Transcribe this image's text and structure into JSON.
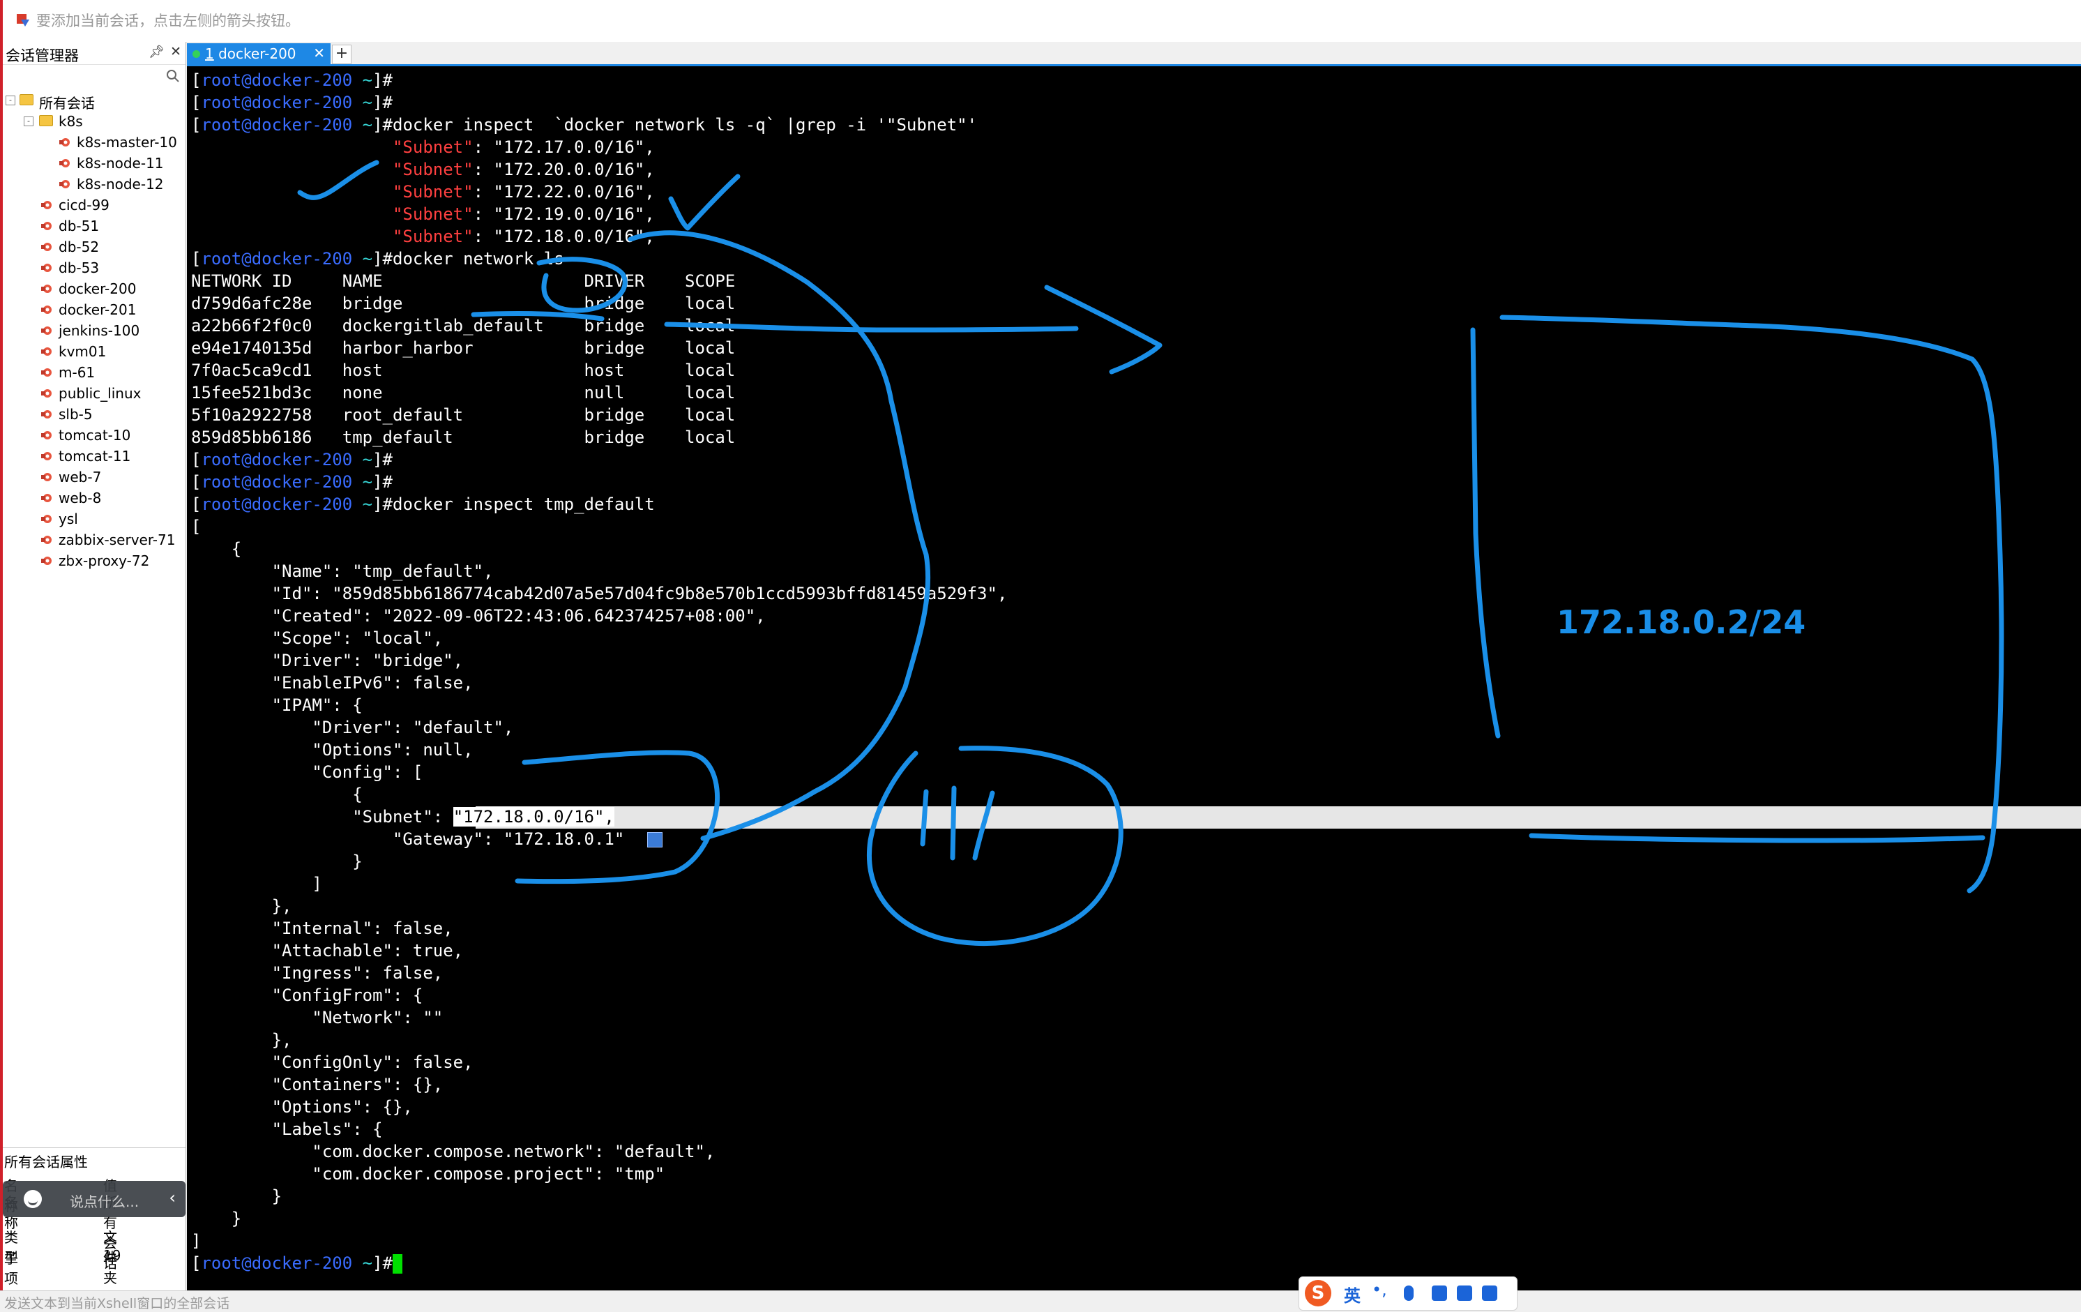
{
  "hint": {
    "text": "要添加当前会话，点击左侧的箭头按钮。"
  },
  "session_manager": {
    "title": "会话管理器",
    "root_label": "所有会话",
    "folder_label": "k8s",
    "folder_children": [
      "k8s-master-10",
      "k8s-node-11",
      "k8s-node-12"
    ],
    "sessions": [
      "cicd-99",
      "db-51",
      "db-52",
      "db-53",
      "docker-200",
      "docker-201",
      "jenkins-100",
      "kvm01",
      "m-61",
      "public_linux",
      "slb-5",
      "tomcat-10",
      "tomcat-11",
      "web-7",
      "web-8",
      "ysl",
      "zabbix-server-71",
      "zbx-proxy-72"
    ]
  },
  "properties": {
    "title": "所有会话属性",
    "name_col": "名称",
    "value_col": "值",
    "rows": [
      {
        "k": "名称",
        "v": "所有会话"
      },
      {
        "k": "类型",
        "v": "文件夹"
      },
      {
        "k": "子项目",
        "v": "19"
      }
    ],
    "chat_placeholder": "说点什么..."
  },
  "tab": {
    "number": "1",
    "label": "docker-200",
    "add": "+"
  },
  "terminal": {
    "prompt_user": "root@docker-200",
    "prompt_dir": "~",
    "cmd_inspect_grep": "docker inspect  `docker network ls -q` |grep -i '\"Subnet\"'",
    "subnets": [
      "172.17.0.0/16",
      "172.20.0.0/16",
      "172.22.0.0/16",
      "172.19.0.0/16",
      "172.18.0.0/16"
    ],
    "cmd_network_ls": "docker network ls",
    "ls_header": "NETWORK ID     NAME                    DRIVER    SCOPE",
    "ls_rows": [
      "d759d6afc28e   bridge                  bridge    local",
      "a22b66f2f0c0   dockergitlab_default    bridge    local",
      "e94e1740135d   harbor_harbor           bridge    local",
      "7f0ac5ca9cd1   host                    host      local",
      "15fee521bd3c   none                    null      local",
      "5f10a2922758   root_default            bridge    local",
      "859d85bb6186   tmp_default             bridge    local"
    ],
    "cmd_inspect_tmp": "docker inspect tmp_default",
    "json_lines": [
      "[",
      "    {",
      "        \"Name\": \"tmp_default\",",
      "        \"Id\": \"859d85bb6186774cab42d07a5e57d04fc9b8e570b1ccd5993bffd81459a529f3\",",
      "        \"Created\": \"2022-09-06T22:43:06.642374257+08:00\",",
      "        \"Scope\": \"local\",",
      "        \"Driver\": \"bridge\",",
      "        \"EnableIPv6\": false,",
      "        \"IPAM\": {",
      "            \"Driver\": \"default\",",
      "            \"Options\": null,",
      "            \"Config\": [",
      "                {"
    ],
    "sel_key": "                \"Subnet\": ",
    "sel_val": "\"172.18.0.0/16\",",
    "json_lines_2": [
      "                    \"Gateway\": \"172.18.0.1\"",
      "                }",
      "            ]",
      "        },",
      "        \"Internal\": false,",
      "        \"Attachable\": true,",
      "        \"Ingress\": false,",
      "        \"ConfigFrom\": {",
      "            \"Network\": \"\"",
      "        },",
      "        \"ConfigOnly\": false,",
      "        \"Containers\": {},",
      "        \"Options\": {},",
      "        \"Labels\": {",
      "            \"com.docker.compose.network\": \"default\",",
      "            \"com.docker.compose.project\": \"tmp\"",
      "        }",
      "    }",
      "]"
    ],
    "ink_color": "#1a8fe8",
    "annotation_ip": "172.18.0.2/24"
  },
  "statusbar": {
    "text": "发送文本到当前Xshell窗口的全部会话"
  },
  "ime": {
    "logo": "S",
    "lang": "英",
    "punct": "•,"
  }
}
